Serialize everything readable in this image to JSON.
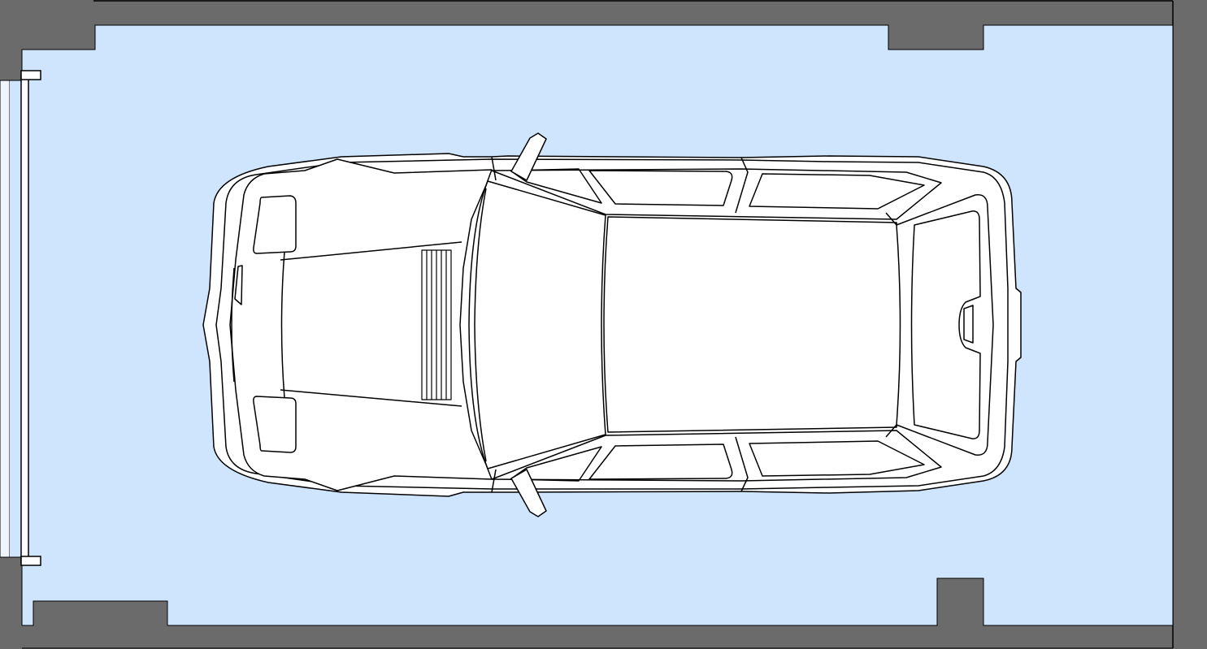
{
  "colors": {
    "wall": "#6b6b6b",
    "floor": "#cfe5fd",
    "car_body": "#ffffff",
    "line": "#000000",
    "door_strip": "#eef5ff"
  },
  "icons": {
    "car": "car-top-view-icon",
    "garage_door": "garage-door-icon"
  }
}
